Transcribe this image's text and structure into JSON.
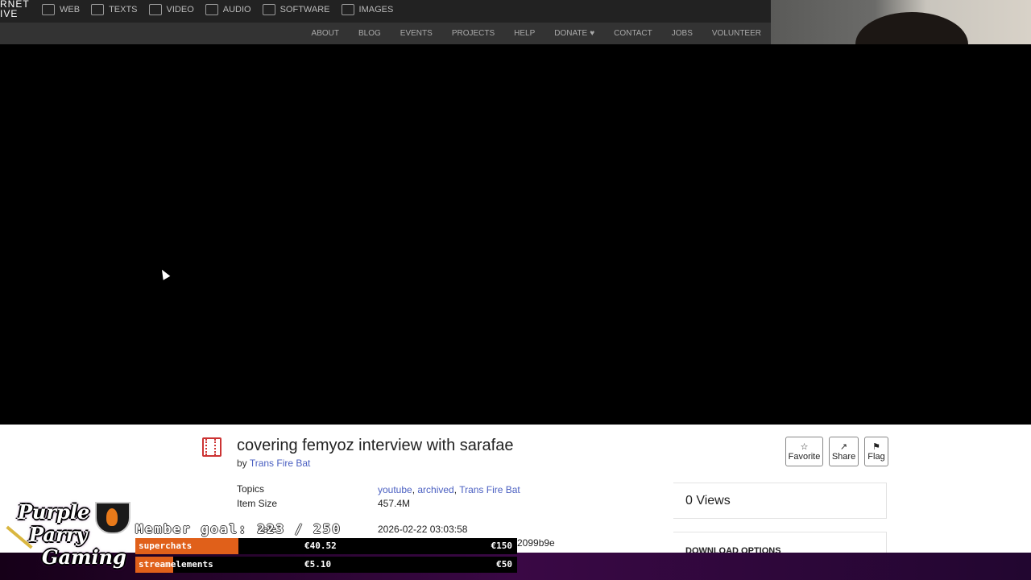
{
  "nav": {
    "logo_lines": [
      "RNET",
      "IVE"
    ],
    "main_items": [
      {
        "label": "WEB",
        "icon": "web-icon"
      },
      {
        "label": "TEXTS",
        "icon": "book-icon"
      },
      {
        "label": "VIDEO",
        "icon": "film-icon"
      },
      {
        "label": "AUDIO",
        "icon": "speaker-icon"
      },
      {
        "label": "SOFTWARE",
        "icon": "floppy-icon"
      },
      {
        "label": "IMAGES",
        "icon": "image-icon"
      }
    ],
    "sub_items": [
      "ABOUT",
      "BLOG",
      "EVENTS",
      "PROJECTS",
      "HELP",
      "DONATE",
      "CONTACT",
      "JOBS",
      "VOLUNTEER"
    ]
  },
  "item": {
    "title": "covering femyoz interview with sarafae",
    "by_prefix": "by",
    "author": "Trans Fire Bat",
    "topics_label": "Topics",
    "topics": [
      "youtube",
      "archived",
      "Trans Fire Bat"
    ],
    "size_label": "Item Size",
    "size": "457.4M",
    "date_label": "date",
    "date": "2026-02-22 03:03:58",
    "partial_id": "2099b9e"
  },
  "actions": {
    "favorite": "Favorite",
    "share": "Share",
    "flag": "Flag"
  },
  "views": "0 Views",
  "download_options": "DOWNLOAD OPTIONS",
  "overlay": {
    "channel_logo_lines": [
      "Purple",
      "Parry",
      "Gaming"
    ],
    "member_goal": "Member goal: 223 / 250",
    "bars": [
      {
        "label": "superchats",
        "amount": "€40.52",
        "goal": "€150",
        "fill_fraction": 0.27
      },
      {
        "label": "streamelements",
        "amount": "€5.10",
        "goal": "€50",
        "fill_fraction": 0.1
      }
    ],
    "accent_color": "#e0601a"
  }
}
